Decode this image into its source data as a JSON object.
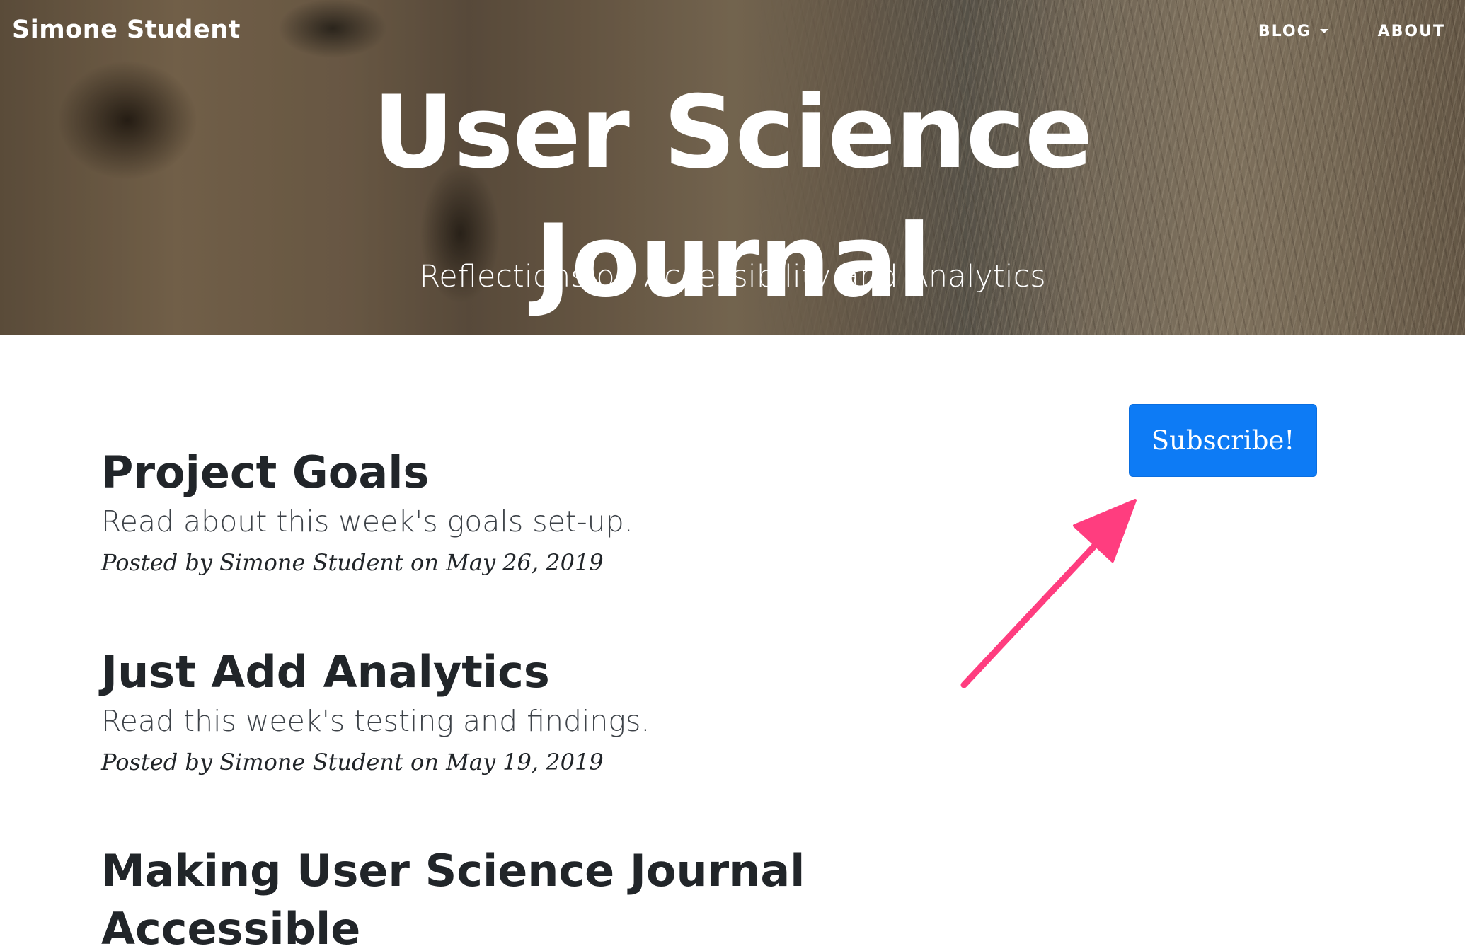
{
  "header": {
    "brand": "Simone Student",
    "nav": {
      "blog_label": "BLOG",
      "about_label": "ABOUT"
    },
    "title_line1": "User Science",
    "title_line2": "Journal",
    "subtitle": "Reflections on Accessibility and Analytics"
  },
  "posts": [
    {
      "title": "Project Goals",
      "subtitle": "Read about this week's goals set-up.",
      "meta": "Posted by Simone Student on May 26, 2019"
    },
    {
      "title": "Just Add Analytics",
      "subtitle": "Read this week's testing and findings.",
      "meta": "Posted by Simone Student on May 19, 2019"
    },
    {
      "title_line1": "Making User Science Journal",
      "title_line2": "Accessible"
    }
  ],
  "subscribe": {
    "label": "Subscribe!"
  },
  "colors": {
    "button": "#0d7bf5",
    "annotation_arrow": "#ff3d7f",
    "text_dark": "#212529"
  },
  "icons": {
    "dropdown": "chevron-down-icon",
    "annotation": "pointer-arrow-icon"
  }
}
